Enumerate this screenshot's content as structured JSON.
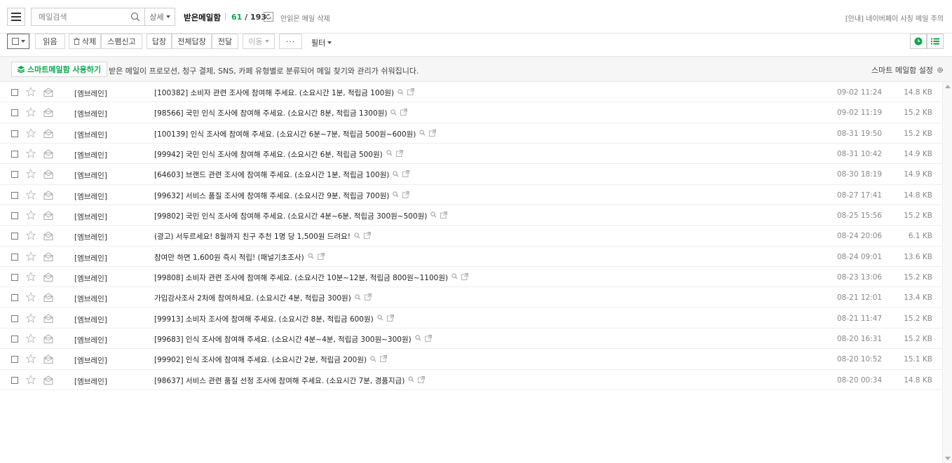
{
  "header": {
    "search_placeholder": "메일검색",
    "detail_label": "상세",
    "mailbox_title": "받은메일함",
    "unread_count": "61",
    "count_sep": "/",
    "total_count": "193",
    "delete_unread_label": "안읽은 메일 삭제",
    "notice": "[안내] 네이버페이 사칭 메일 주의"
  },
  "toolbar": {
    "read": "읽음",
    "delete": "삭제",
    "spam": "스팸신고",
    "reply": "답장",
    "reply_all": "전체답장",
    "forward": "전달",
    "move": "이동",
    "more": "···",
    "filter": "필터"
  },
  "smart": {
    "button": "스마트메일함 사용하기",
    "description": "받은 메일이 프로모션, 청구 결제, SNS, 카페 유형별로 분류되어 메일 찾기와 관리가 쉬워집니다.",
    "settings": "스마트 메일함 설정"
  },
  "colors": {
    "accent": "#03a94e",
    "text": "#333333",
    "muted": "#888888"
  },
  "mails": [
    {
      "sender": "[엠브레인]",
      "subject": "[100382] 소비자 관련 조사에 참여해 주세요. (소요시간 1분, 적립금 100원)",
      "date": "09-02 11:24",
      "size": "14.8 KB"
    },
    {
      "sender": "[엠브레인]",
      "subject": "[98566] 국민 인식 조사에 참여해 주세요. (소요시간 8분, 적립금 1300원)",
      "date": "09-02 11:19",
      "size": "15.2 KB"
    },
    {
      "sender": "[엠브레인]",
      "subject": "[100139] 인식 조사에 참여해 주세요. (소요시간 6분~7분, 적립금 500원~600원)",
      "date": "08-31 19:50",
      "size": "15.2 KB"
    },
    {
      "sender": "[엠브레인]",
      "subject": "[99942] 국민 인식 조사에 참여해 주세요. (소요시간 6분, 적립금 500원)",
      "date": "08-31 10:42",
      "size": "14.9 KB"
    },
    {
      "sender": "[엠브레인]",
      "subject": "[64603] 브랜드 관련 조사에 참여해 주세요. (소요시간 1분, 적립금 100원)",
      "date": "08-30 18:19",
      "size": "14.9 KB"
    },
    {
      "sender": "[엠브레인]",
      "subject": "[99632] 서비스 품질 조사에 참여해 주세요. (소요시간 9분, 적립금 700원)",
      "date": "08-27 17:41",
      "size": "14.8 KB"
    },
    {
      "sender": "[엠브레인]",
      "subject": "[99802] 국민 인식 조사에 참여해 주세요. (소요시간 4분~6분, 적립금 300원~500원)",
      "date": "08-25 15:56",
      "size": "15.2 KB"
    },
    {
      "sender": "[엠브레인]",
      "subject": "(광고) 서두르세요! 8월까지 친구 추천 1명 당 1,500원 드려요!",
      "date": "08-24 20:06",
      "size": "6.1 KB"
    },
    {
      "sender": "[엠브레인]",
      "subject": "참여만 하면 1,600원 즉시 적립! (패널기초조사)",
      "date": "08-24 09:01",
      "size": "13.6 KB"
    },
    {
      "sender": "[엠브레인]",
      "subject": "[99808] 소비자 관련 조사에 참여해 주세요. (소요시간 10분~12분, 적립금 800원~1100원)",
      "date": "08-23 13:06",
      "size": "15.2 KB"
    },
    {
      "sender": "[엠브레인]",
      "subject": "가입감사조사 2차에 참여하세요. (소요시간 4분, 적립금 300원)",
      "date": "08-21 12:01",
      "size": "13.4 KB"
    },
    {
      "sender": "[엠브레인]",
      "subject": "[99913] 소비자 조사에 참여해 주세요. (소요시간 8분, 적립금 600원)",
      "date": "08-21 11:47",
      "size": "15.2 KB"
    },
    {
      "sender": "[엠브레인]",
      "subject": "[99683] 인식 조사에 참여해 주세요. (소요시간 4분~4분, 적립금 300원~300원)",
      "date": "08-20 16:31",
      "size": "15.2 KB"
    },
    {
      "sender": "[엠브레인]",
      "subject": "[99902] 인식 조사에 참여해 주세요. (소요시간 2분, 적립금 200원)",
      "date": "08-20 10:52",
      "size": "15.1 KB"
    },
    {
      "sender": "[엠브레인]",
      "subject": "[98637] 서비스 관련 품질 선정 조사에 참여해 주세요. (소요시간 7분, 경품지급)",
      "date": "08-20 00:34",
      "size": "14.8 KB"
    }
  ]
}
